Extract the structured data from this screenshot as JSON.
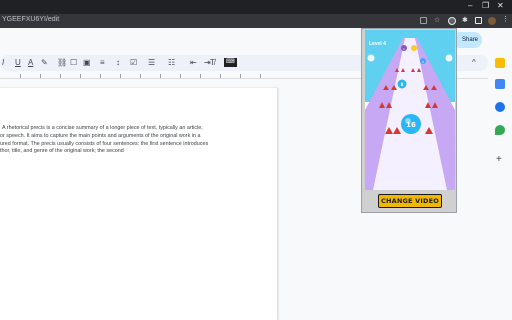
{
  "browser": {
    "url": "YGEEFXU6YI/edit",
    "window_controls": [
      "–",
      "❐",
      "✕"
    ]
  },
  "docs": {
    "share_label": "Share",
    "toolbar": {
      "italic": "I",
      "underline": "U",
      "text_color": "A",
      "highlight": "✎",
      "link": "⛓",
      "comment": "☐",
      "image": "▣",
      "align": "≡",
      "line_spacing": "↕",
      "checklist": "☑",
      "bullets": "☰",
      "numbered": "☷",
      "indent_less": "⇤",
      "indent_more": "⇥",
      "clear_format": "T̸",
      "keyboard": "⌨",
      "collapse": "^"
    },
    "body_lines": [
      "A rhetorical precis is a concise summary of a longer piece of text, typically an article,",
      "or speech. It aims to capture the main points and arguments of the original work in a",
      "ured format. The precis usually consists of four sentences: the first sentence introduces",
      "thor, title, and genre of the original work; the second"
    ]
  },
  "extension_popup": {
    "level_label": "Level 4",
    "ball_numbers": [
      "16",
      "8",
      "2",
      "1"
    ],
    "change_button": "CHANGE VIDEO"
  },
  "colors": {
    "game_sky": "#5fd0ef",
    "game_track": "#f4f0ff",
    "game_side": "#c7a8f4",
    "spike": "#d63a2f",
    "ball": "#29b6f6",
    "button": "#f0b800"
  }
}
